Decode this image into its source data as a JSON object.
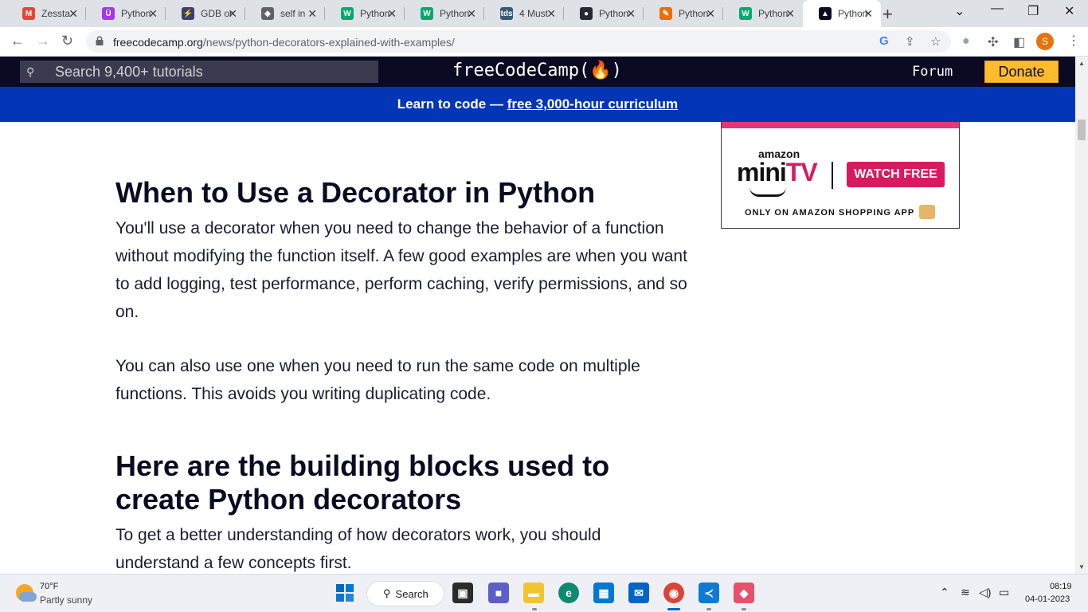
{
  "browser": {
    "tabs": [
      {
        "title": "Zessta",
        "icon": "gmail-icon",
        "color": "#ea4335",
        "glyph": "M"
      },
      {
        "title": "Python",
        "icon": "udemy-icon",
        "color": "#a435f0",
        "glyph": "Ü"
      },
      {
        "title": "GDB online",
        "icon": "gdb-icon",
        "color": "#3a3f6b",
        "glyph": "⚡"
      },
      {
        "title": "self in",
        "icon": "diamond-icon",
        "color": "#5f6368",
        "glyph": "◈"
      },
      {
        "title": "Python",
        "icon": "w3schools-icon",
        "color": "#04aa6d",
        "glyph": "W"
      },
      {
        "title": "Python",
        "icon": "w3schools-icon",
        "color": "#04aa6d",
        "glyph": "W"
      },
      {
        "title": "4 Must",
        "icon": "tds-icon",
        "color": "#355876",
        "glyph": "tds"
      },
      {
        "title": "Python",
        "icon": "github-icon",
        "color": "#24292f",
        "glyph": "●"
      },
      {
        "title": "Python",
        "icon": "feather-icon",
        "color": "#ef6c00",
        "glyph": "✎"
      },
      {
        "title": "Python",
        "icon": "w3schools-icon",
        "color": "#04aa6d",
        "glyph": "W"
      },
      {
        "title": "Python",
        "icon": "freecodecamp-icon",
        "color": "#0a0a23",
        "glyph": "▲"
      }
    ],
    "url_domain": "freecodecamp.org",
    "url_path": "/news/python-decorators-explained-with-examples/",
    "profile_initial": "S"
  },
  "fcc": {
    "search_placeholder": "Search 9,400+ tutorials",
    "logo": "freeCodeCamp(🔥)",
    "forum": "Forum",
    "donate": "Donate",
    "banner_prefix": "Learn to code — ",
    "banner_link": "free 3,000-hour curriculum"
  },
  "article": {
    "h2_1": "When to Use a Decorator in Python",
    "p1": "You'll use a decorator when you need to change the behavior of a function without modifying the function itself. A few good examples are when you want to add logging, test performance, perform caching, verify permissions, and so on.",
    "p2": "You can also use one when you need to run the same code on multiple functions. This avoids you writing duplicating code.",
    "h2_2": "Here are the building blocks used to create Python decorators",
    "p3": "To get a better understanding of how decorators work, you should understand a few concepts first."
  },
  "ad": {
    "amazon": "amazon",
    "mini": "mini",
    "tv": "TV",
    "watch": "WATCH FREE",
    "only": "ONLY ON AMAZON SHOPPING APP"
  },
  "taskbar": {
    "temp": "70°F",
    "weather": "Partly sunny",
    "search": "Search",
    "time": "08:19",
    "date": "04-01-2023"
  }
}
